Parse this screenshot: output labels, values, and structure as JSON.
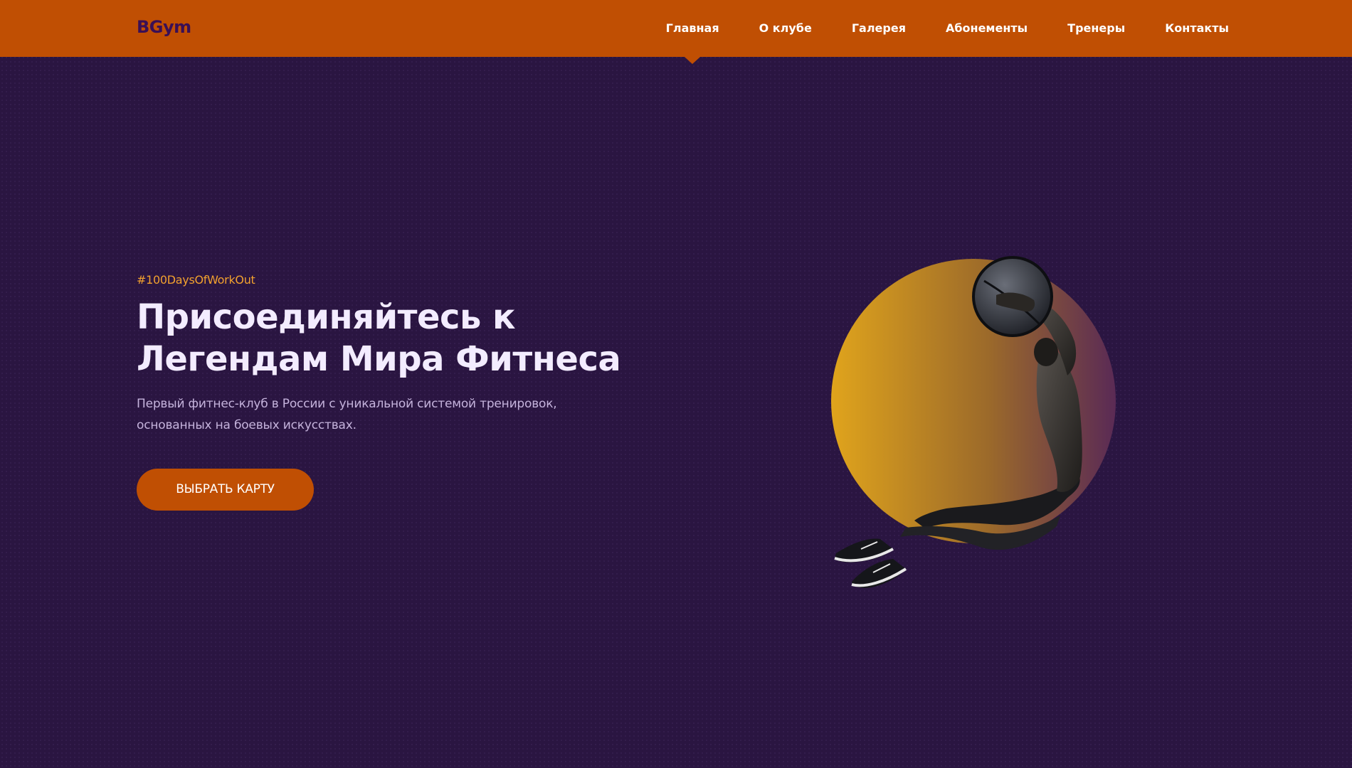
{
  "header": {
    "logo": "BGym",
    "nav": [
      {
        "label": "Главная",
        "active": true
      },
      {
        "label": "О клубе",
        "active": false
      },
      {
        "label": "Галерея",
        "active": false
      },
      {
        "label": "Абонементы",
        "active": false
      },
      {
        "label": "Тренеры",
        "active": false
      },
      {
        "label": "Контакты",
        "active": false
      }
    ]
  },
  "hero": {
    "hashtag": "#100DaysOfWorkOut",
    "title_line1": "Присоединяйтесь к",
    "title_line2": "Легендам Мира Фитнеса",
    "subtitle_line1": "Первый фитнес-клуб в России с уникальной системой тренировок,",
    "subtitle_line2": "основанных на боевых искусствах.",
    "cta_label": "ВЫБРАТЬ КАРТУ",
    "image_alt": "athlete-jumping-with-medicine-ball"
  },
  "colors": {
    "background": "#2a1541",
    "header": "#c04f03",
    "logo": "#3a0f55",
    "accent": "#f2a12e",
    "button": "#c04f03",
    "circle_gradient_start": "#e0a41c",
    "circle_gradient_end": "#5a2a55"
  }
}
